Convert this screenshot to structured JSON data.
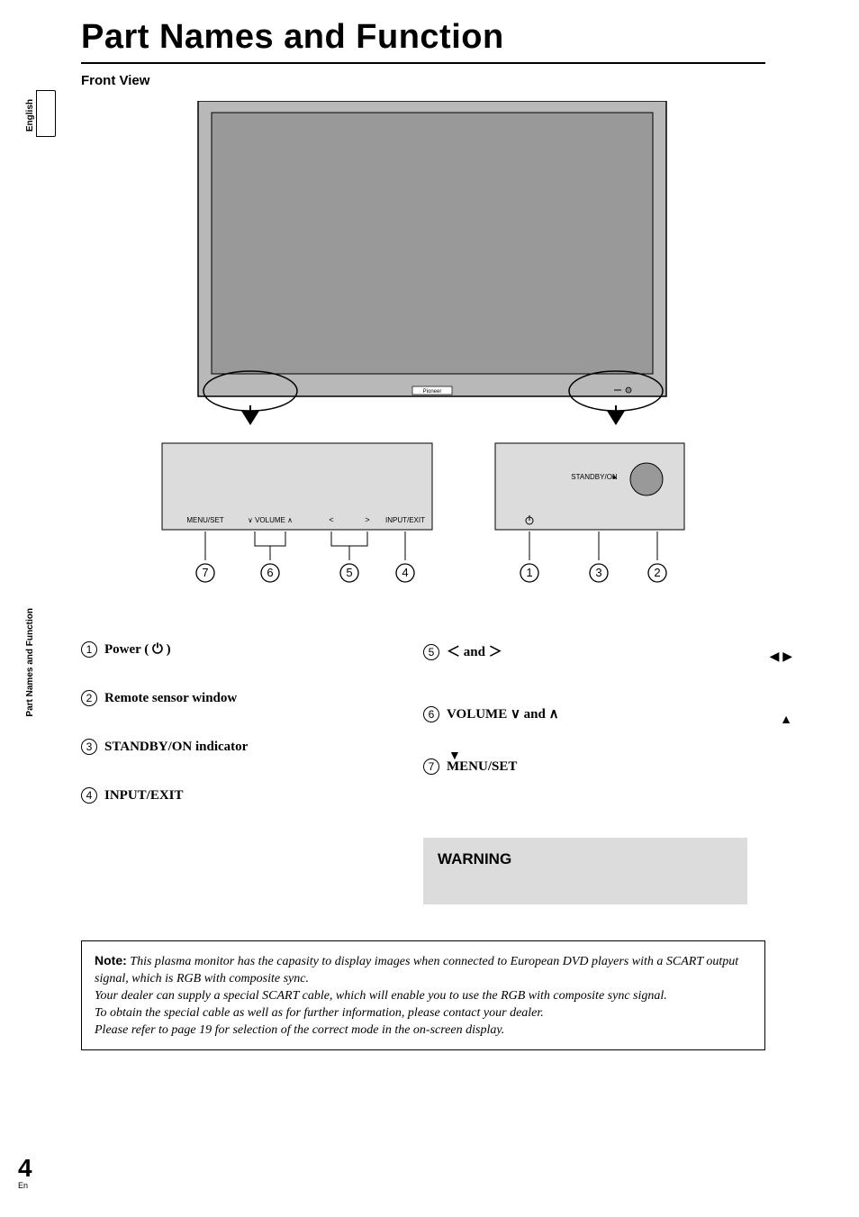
{
  "sidebar": {
    "english": "English",
    "section": "Part Names and Function"
  },
  "title": "Part Names and Function",
  "subheading": "Front View",
  "diagram": {
    "brand": "Pioneer",
    "panel_labels": {
      "menu_set": "MENU/SET",
      "volume": "VOLUME",
      "input_exit": "INPUT/EXIT",
      "standby_on": "STANDBY/ON"
    }
  },
  "items_left": [
    {
      "n": "1",
      "label": "Power ( ⏻ )"
    },
    {
      "n": "2",
      "label": "Remote sensor window"
    },
    {
      "n": "3",
      "label": "STANDBY/ON indicator"
    },
    {
      "n": "4",
      "label": "INPUT/EXIT"
    }
  ],
  "items_right": [
    {
      "n": "5",
      "label": "＜ and ＞"
    },
    {
      "n": "6",
      "label": "VOLUME ∨ and ∧"
    },
    {
      "n": "7",
      "label": "MENU/SET"
    }
  ],
  "arrows": {
    "lr": "◀ ▶",
    "down": "▼",
    "up": "▲"
  },
  "warning": {
    "heading": "WARNING"
  },
  "note": {
    "label": "Note:",
    "l1": "This plasma monitor has the capasity to display images when connected to European DVD players with a SCART output signal, which is RGB with composite sync.",
    "l2": "Your dealer can supply a special SCART cable, which will enable you to use the RGB with composite sync signal.",
    "l3": "To obtain the special cable as well as for further information, please contact your dealer.",
    "l4": "Please refer to page 19 for selection of the correct mode in the on-screen display."
  },
  "page": {
    "number": "4",
    "lang": "En"
  }
}
